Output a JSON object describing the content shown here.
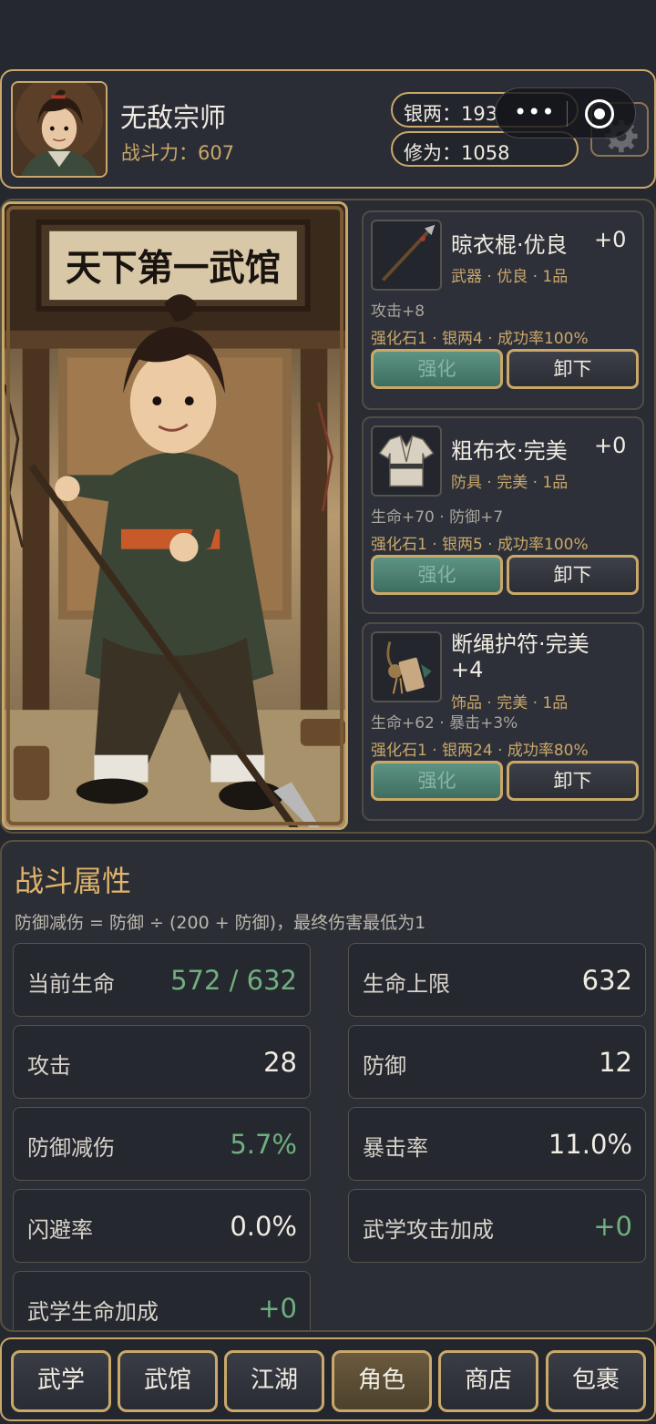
{
  "header": {
    "player_name": "无敌宗师",
    "power_label": "战斗力：",
    "power_value": "607",
    "silver_label": "银两：",
    "silver_value": "193",
    "cultivation_label": "修为：",
    "cultivation_value": "1058"
  },
  "portrait": {
    "sign": "天下第一武馆"
  },
  "equipment": [
    {
      "name": "晾衣棍·优良",
      "level": "+0",
      "type": "武器 · 优良 · 1品",
      "stats": "攻击+8",
      "cost": "强化石1 · 银两4 · 成功率100%",
      "enhance_label": "强化",
      "unequip_label": "卸下",
      "icon": "spear-icon"
    },
    {
      "name": "粗布衣·完美",
      "level": "+0",
      "type": "防具 · 完美 · 1品",
      "stats": "生命+70 · 防御+7",
      "cost": "强化石1 · 银两5 · 成功率100%",
      "enhance_label": "强化",
      "unequip_label": "卸下",
      "icon": "robe-icon"
    },
    {
      "name": "断绳护符·完美",
      "level": "+4",
      "type": "饰品 · 完美 · 1品",
      "stats": "生命+62 · 暴击+3%",
      "cost": "强化石1 · 银两24 · 成功率80%",
      "enhance_label": "强化",
      "unequip_label": "卸下",
      "icon": "amulet-icon"
    }
  ],
  "stats": {
    "title": "战斗属性",
    "formula": "防御减伤 = 防御 ÷ (200 + 防御)，最终伤害最低为1",
    "items": [
      {
        "label": "当前生命",
        "value": "572 / 632",
        "accent": "green"
      },
      {
        "label": "生命上限",
        "value": "632"
      },
      {
        "label": "攻击",
        "value": "28"
      },
      {
        "label": "防御",
        "value": "12"
      },
      {
        "label": "防御减伤",
        "value": "5.7%",
        "accent": "green"
      },
      {
        "label": "暴击率",
        "value": "11.0%"
      },
      {
        "label": "闪避率",
        "value": "0.0%"
      },
      {
        "label": "武学攻击加成",
        "value": "+0",
        "accent": "green"
      },
      {
        "label": "武学生命加成",
        "value": "+0",
        "accent": "green"
      }
    ]
  },
  "nav": {
    "tabs": [
      "武学",
      "武馆",
      "江湖",
      "角色",
      "商店",
      "包裹"
    ],
    "active": "角色"
  },
  "colors": {
    "gold": "#c9a86a",
    "background": "#262830",
    "green": "#6fb07e",
    "enhance": "#4e8070"
  }
}
